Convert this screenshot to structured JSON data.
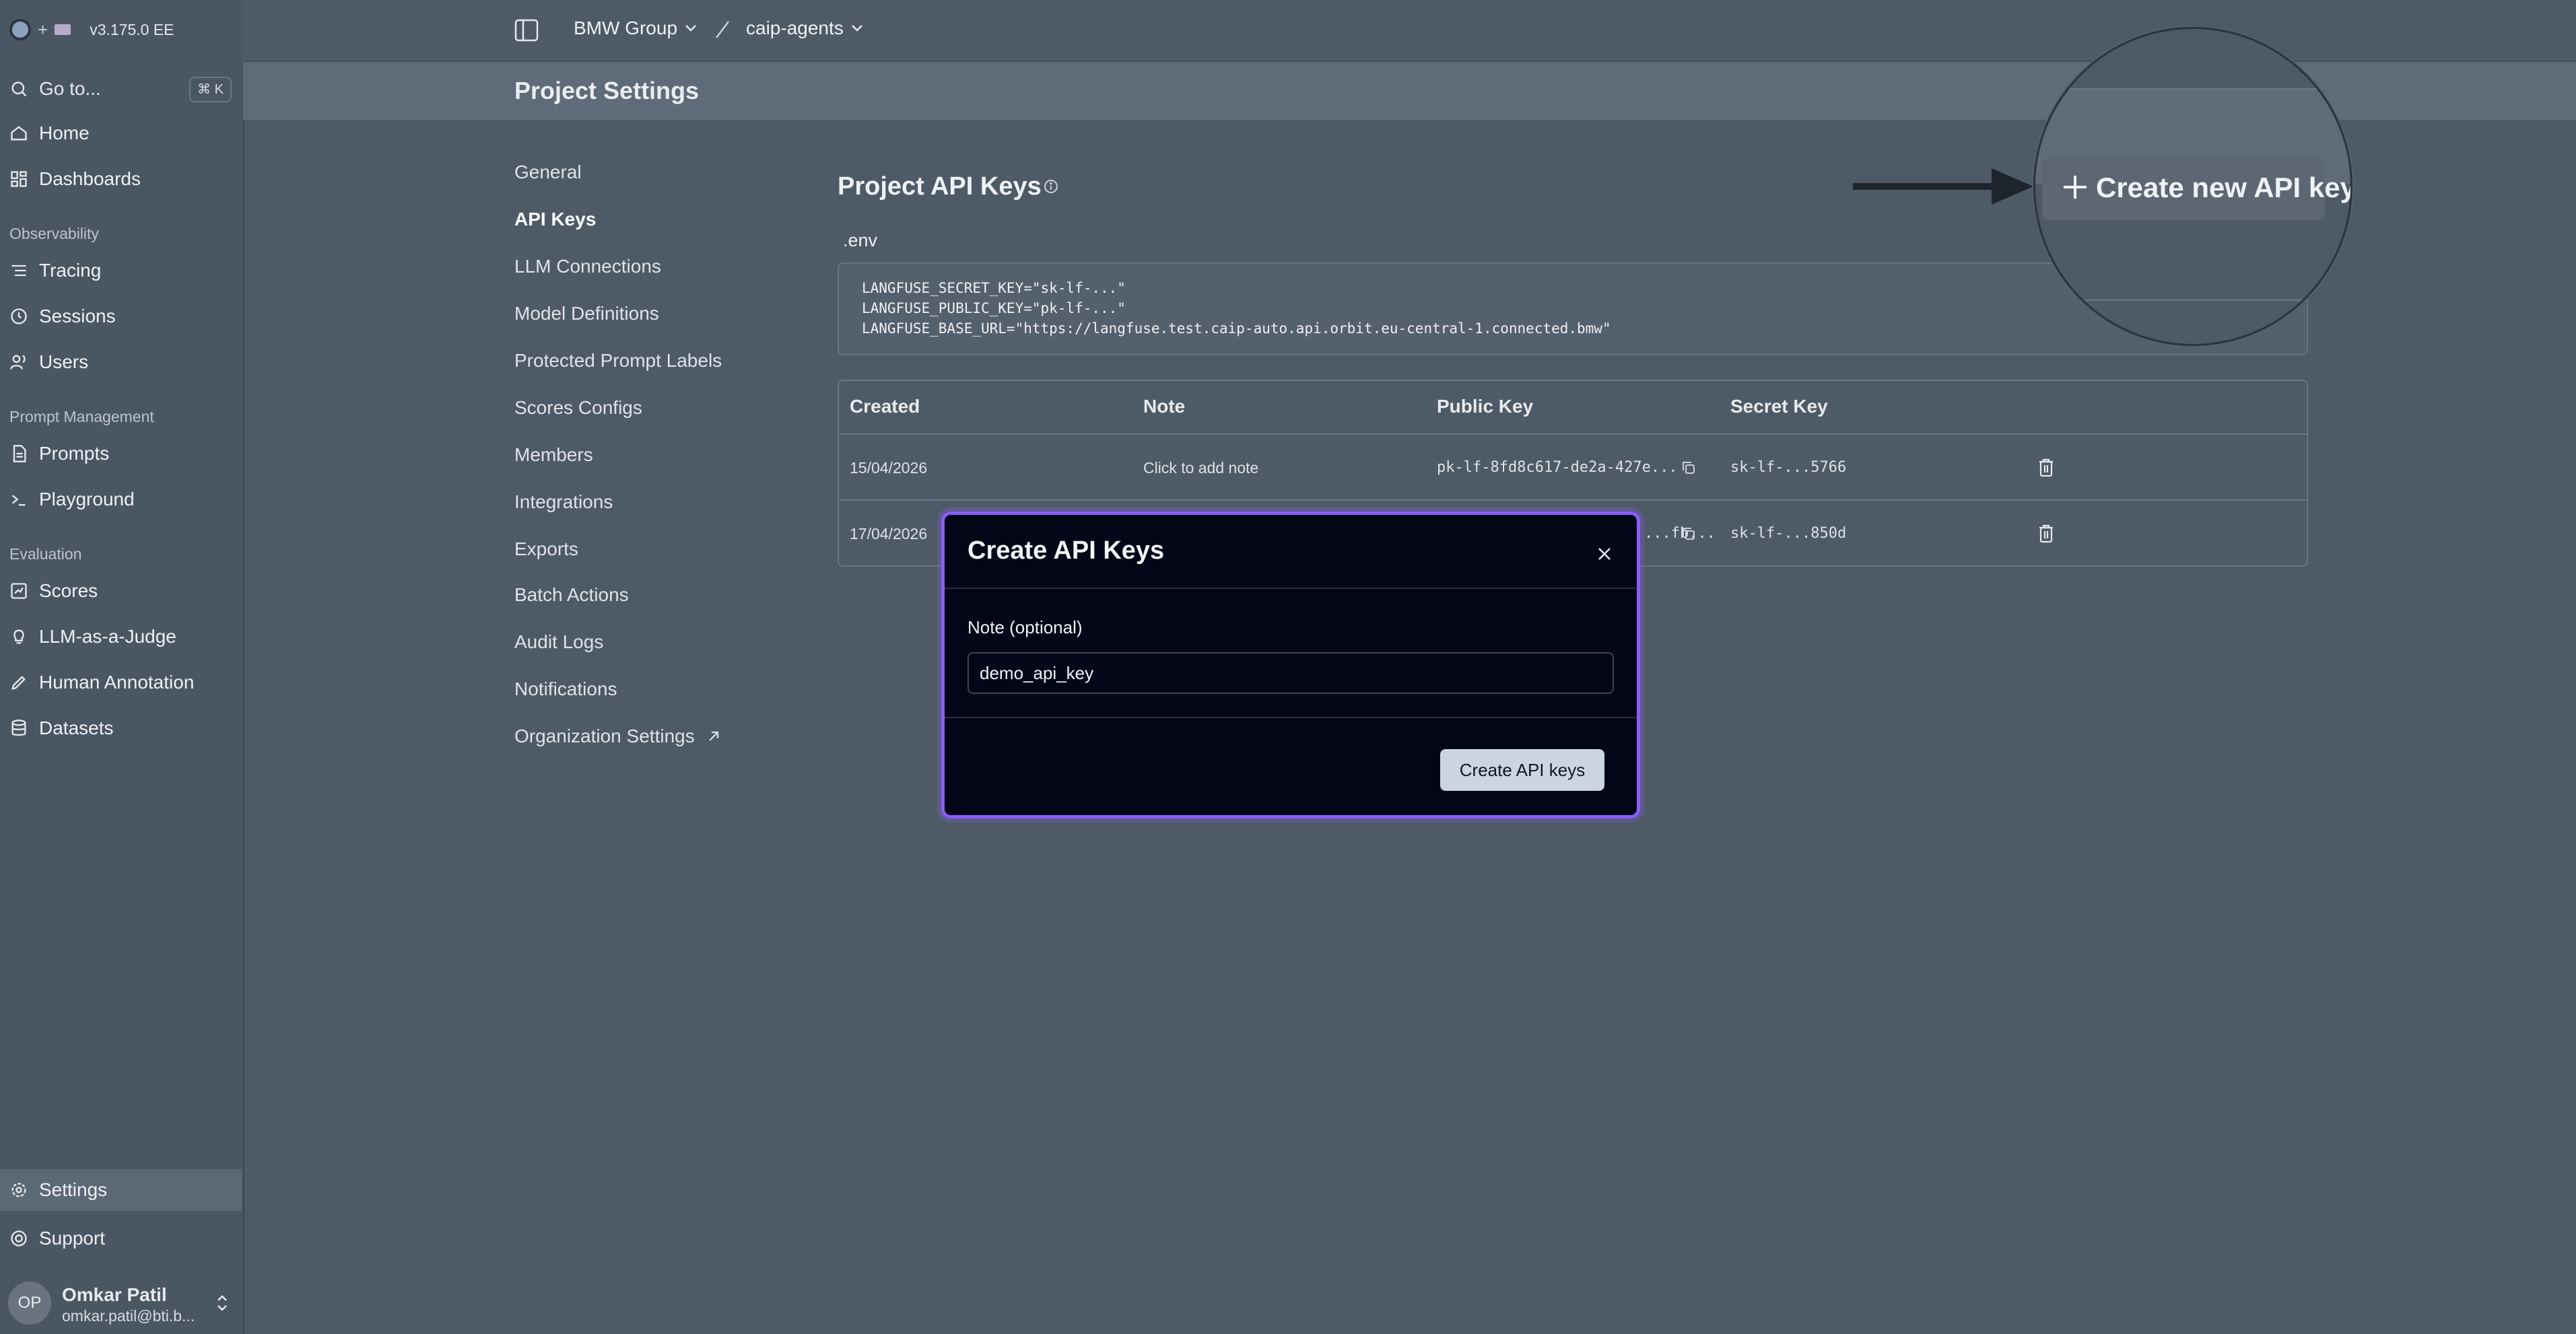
{
  "sidebar": {
    "version": "v3.175.0 EE",
    "brand_plus": "+",
    "goto": {
      "label": "Go to...",
      "shortcut": "⌘ K"
    },
    "items": [
      {
        "label": "Home",
        "icon": "home-icon"
      },
      {
        "label": "Dashboards",
        "icon": "dashboard-icon"
      }
    ],
    "sections": [
      {
        "title": "Observability",
        "items": [
          {
            "label": "Tracing",
            "icon": "list-icon"
          },
          {
            "label": "Sessions",
            "icon": "clock-icon"
          },
          {
            "label": "Users",
            "icon": "users-icon"
          }
        ]
      },
      {
        "title": "Prompt Management",
        "items": [
          {
            "label": "Prompts",
            "icon": "file-text-icon"
          },
          {
            "label": "Playground",
            "icon": "terminal-icon"
          }
        ]
      },
      {
        "title": "Evaluation",
        "items": [
          {
            "label": "Scores",
            "icon": "scores-icon"
          },
          {
            "label": "LLM-as-a-Judge",
            "icon": "lightbulb-icon"
          },
          {
            "label": "Human Annotation",
            "icon": "annotate-icon"
          },
          {
            "label": "Datasets",
            "icon": "database-icon"
          }
        ]
      }
    ],
    "settings": "Settings",
    "support": "Support",
    "user": {
      "initials": "OP",
      "name": "Omkar Patil",
      "email": "omkar.patil@bti.b..."
    }
  },
  "topbar": {
    "org": "BMW Group",
    "project": "caip-agents"
  },
  "page": {
    "title": "Project Settings"
  },
  "subnav": {
    "items": [
      "General",
      "API Keys",
      "LLM Connections",
      "Model Definitions",
      "Protected Prompt Labels",
      "Scores Configs",
      "Members",
      "Integrations",
      "Exports",
      "Batch Actions",
      "Audit Logs",
      "Notifications"
    ],
    "active": "API Keys",
    "org_settings": "Organization Settings"
  },
  "api_keys": {
    "title": "Project API Keys",
    "env_label": ".env",
    "env_lines": [
      "LANGFUSE_SECRET_KEY=\"sk-lf-...\"",
      "LANGFUSE_PUBLIC_KEY=\"pk-lf-...\"",
      "LANGFUSE_BASE_URL=\"https://langfuse.test.caip-auto.api.orbit.eu-central-1.connected.bmw\""
    ],
    "create_button": "Create new API keys",
    "columns": [
      "Created",
      "Note",
      "Public Key",
      "Secret Key"
    ],
    "rows": [
      {
        "created": "15/04/2026",
        "note": "Click to add note",
        "public_key": "pk-lf-8fd8c617-de2a-427e...",
        "secret_key": "sk-lf-...5766"
      },
      {
        "created": "17/04/2026",
        "note": "",
        "public_key": "...fb...",
        "secret_key": "sk-lf-...850d"
      }
    ]
  },
  "modal": {
    "title": "Create API Keys",
    "note_label": "Note (optional)",
    "note_value": "demo_api_key",
    "submit": "Create API keys"
  },
  "colors": {
    "accent": "#8b5cf6",
    "modal_bg": "#020617",
    "page_bg": "#4f5a67"
  }
}
